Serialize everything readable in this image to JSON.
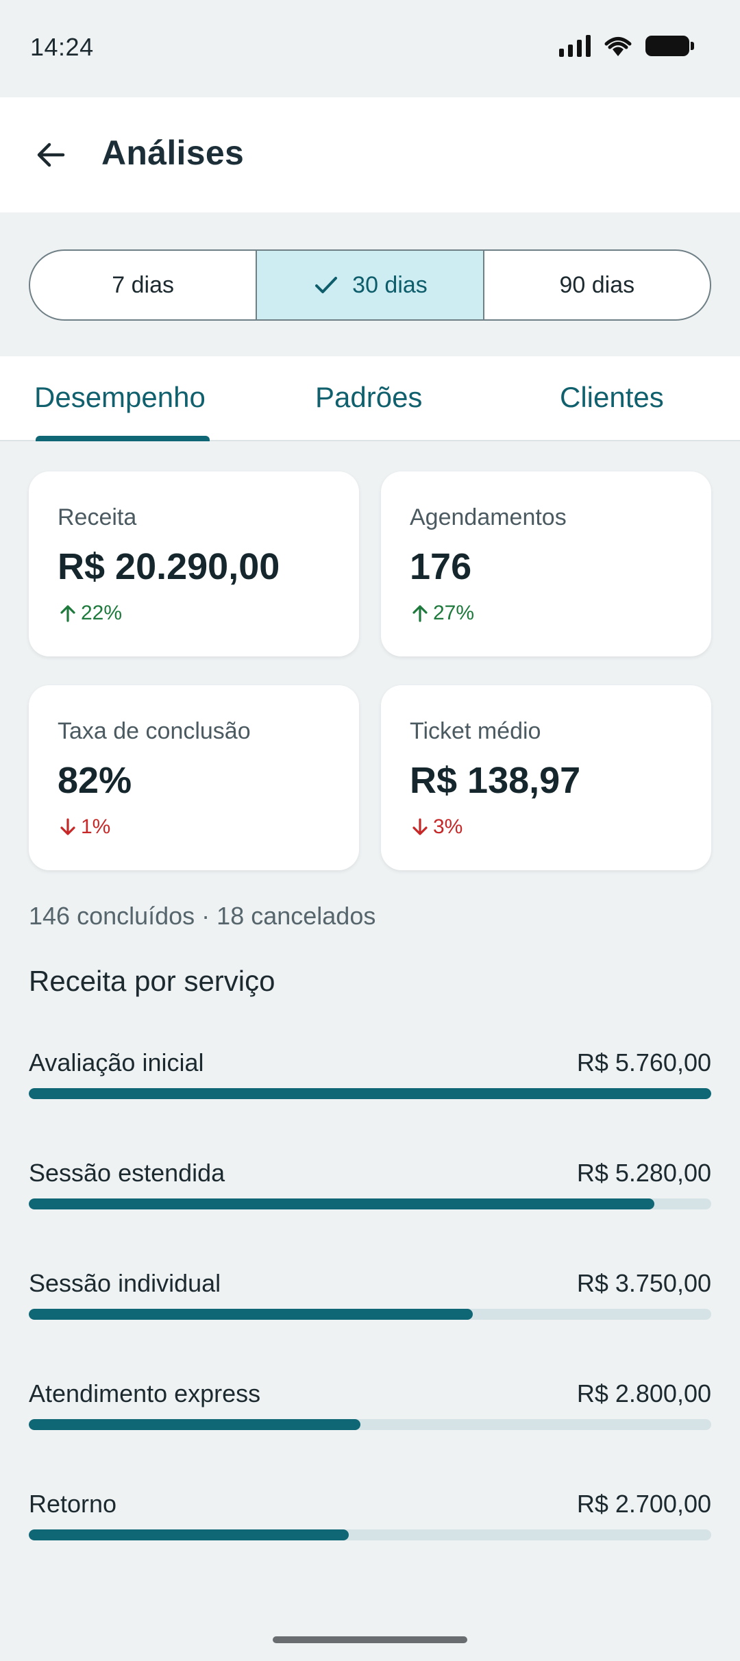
{
  "status_bar": {
    "time": "14:24"
  },
  "app_bar": {
    "title": "Análises"
  },
  "range": {
    "options": [
      "7 dias",
      "30 dias",
      "90 dias"
    ],
    "selected": "30 dias"
  },
  "tabs": [
    {
      "label": "Desempenho",
      "active": true
    },
    {
      "label": "Padrões",
      "active": false
    },
    {
      "label": "Clientes",
      "active": false
    }
  ],
  "metrics": [
    {
      "label": "Receita",
      "value": "R$ 20.290,00",
      "trend": "22%",
      "direction": "up"
    },
    {
      "label": "Agendamentos",
      "value": "176",
      "trend": "27%",
      "direction": "up"
    },
    {
      "label": "Taxa de conclusão",
      "value": "82%",
      "trend": "1%",
      "direction": "down"
    },
    {
      "label": "Ticket médio",
      "value": "R$ 138,97",
      "trend": "3%",
      "direction": "down"
    }
  ],
  "summary": "146 concluídos · 18 cancelados",
  "revenue_section": {
    "title": "Receita por serviço",
    "services": [
      {
        "name": "Avaliação inicial",
        "value": "R$ 5.760,00",
        "amount": 5760
      },
      {
        "name": "Sessão estendida",
        "value": "R$ 5.280,00",
        "amount": 5280
      },
      {
        "name": "Sessão individual",
        "value": "R$ 3.750,00",
        "amount": 3750
      },
      {
        "name": "Atendimento express",
        "value": "R$ 2.800,00",
        "amount": 2800
      },
      {
        "name": "Retorno",
        "value": "R$ 2.700,00",
        "amount": 2700
      }
    ]
  },
  "colors": {
    "accent": "#0f6674",
    "selected_segment_bg": "#cdedf3",
    "trend_up": "#1e7a3c",
    "trend_down": "#c62828"
  }
}
